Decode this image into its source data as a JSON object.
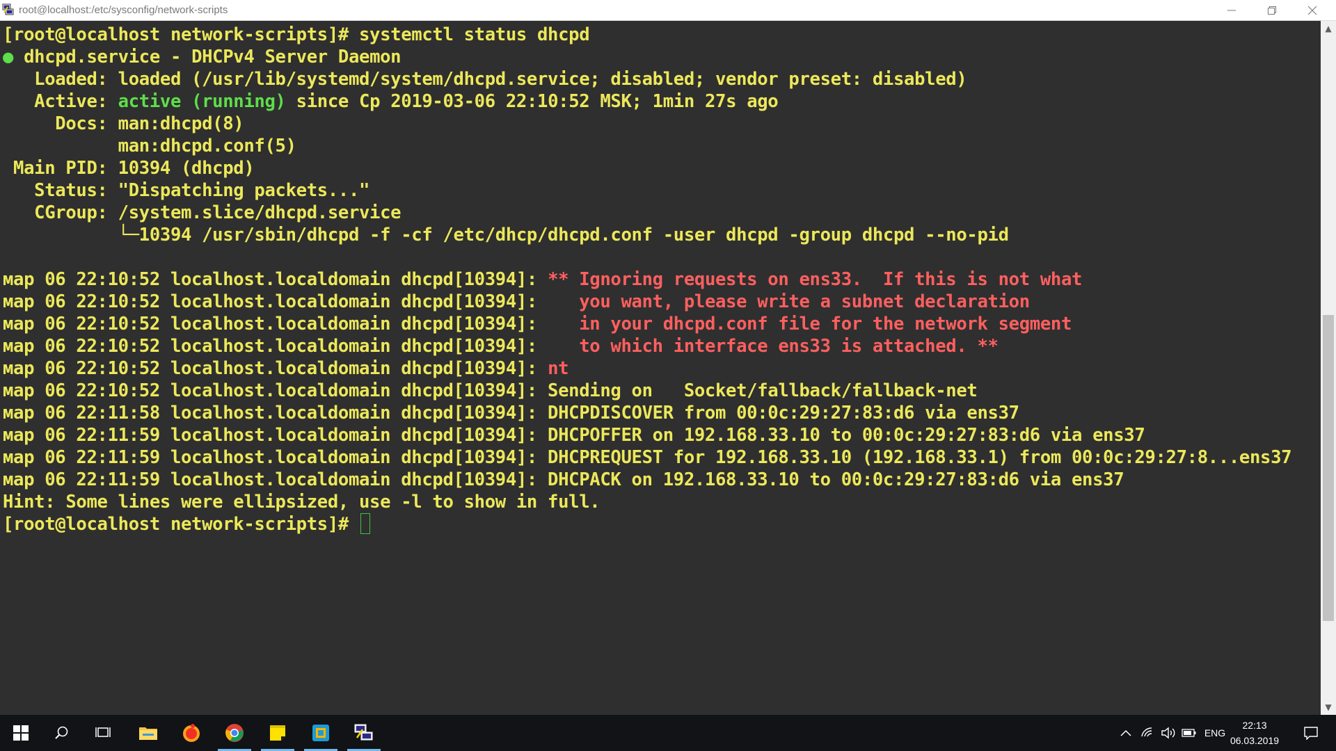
{
  "window": {
    "title": "root@localhost:/etc/sysconfig/network-scripts",
    "minimize_icon": "minimize-icon",
    "restore_icon": "restore-icon",
    "close_icon": "close-icon"
  },
  "terminal": {
    "lines": [
      {
        "segments": [
          {
            "text": "[root@localhost network-scripts]# systemctl status dhcpd",
            "color": "yellow"
          }
        ]
      },
      {
        "segments": [
          {
            "text": "● ",
            "color": "green"
          },
          {
            "text": "dhcpd.service - DHCPv4 Server Daemon",
            "color": "yellow"
          }
        ]
      },
      {
        "segments": [
          {
            "text": "   Loaded: loaded (/usr/lib/systemd/system/dhcpd.service; disabled; vendor preset: disabled)",
            "color": "yellow"
          }
        ]
      },
      {
        "segments": [
          {
            "text": "   Active: ",
            "color": "yellow"
          },
          {
            "text": "active (running)",
            "color": "green"
          },
          {
            "text": " since Ср 2019-03-06 22:10:52 MSK; 1min 27s ago",
            "color": "yellow"
          }
        ]
      },
      {
        "segments": [
          {
            "text": "     Docs: man:dhcpd(8)",
            "color": "yellow"
          }
        ]
      },
      {
        "segments": [
          {
            "text": "           man:dhcpd.conf(5)",
            "color": "yellow"
          }
        ]
      },
      {
        "segments": [
          {
            "text": " Main PID: 10394 (dhcpd)",
            "color": "yellow"
          }
        ]
      },
      {
        "segments": [
          {
            "text": "   Status: \"Dispatching packets...\"",
            "color": "yellow"
          }
        ]
      },
      {
        "segments": [
          {
            "text": "   CGroup: /system.slice/dhcpd.service",
            "color": "yellow"
          }
        ]
      },
      {
        "segments": [
          {
            "text": "           └─10394 /usr/sbin/dhcpd -f -cf /etc/dhcp/dhcpd.conf -user dhcpd -group dhcpd --no-pid",
            "color": "yellow"
          }
        ]
      },
      {
        "segments": [
          {
            "text": "",
            "color": "yellow"
          }
        ]
      },
      {
        "segments": [
          {
            "text": "мар 06 22:10:52 localhost.localdomain dhcpd[10394]: ",
            "color": "yellow"
          },
          {
            "text": "** Ignoring requests on ens33.  If this is not what",
            "color": "red"
          }
        ]
      },
      {
        "segments": [
          {
            "text": "мар 06 22:10:52 localhost.localdomain dhcpd[10394]: ",
            "color": "yellow"
          },
          {
            "text": "   you want, please write a subnet declaration",
            "color": "red"
          }
        ]
      },
      {
        "segments": [
          {
            "text": "мар 06 22:10:52 localhost.localdomain dhcpd[10394]: ",
            "color": "yellow"
          },
          {
            "text": "   in your dhcpd.conf file for the network segment",
            "color": "red"
          }
        ]
      },
      {
        "segments": [
          {
            "text": "мар 06 22:10:52 localhost.localdomain dhcpd[10394]: ",
            "color": "yellow"
          },
          {
            "text": "   to which interface ens33 is attached. **",
            "color": "red"
          }
        ]
      },
      {
        "segments": [
          {
            "text": "мар 06 22:10:52 localhost.localdomain dhcpd[10394]: ",
            "color": "yellow"
          },
          {
            "text": "nt",
            "color": "red"
          }
        ]
      },
      {
        "segments": [
          {
            "text": "мар 06 22:10:52 localhost.localdomain dhcpd[10394]: Sending on   Socket/fallback/fallback-net",
            "color": "yellow"
          }
        ]
      },
      {
        "segments": [
          {
            "text": "мар 06 22:11:58 localhost.localdomain dhcpd[10394]: DHCPDISCOVER from 00:0c:29:27:83:d6 via ens37",
            "color": "yellow"
          }
        ]
      },
      {
        "segments": [
          {
            "text": "мар 06 22:11:59 localhost.localdomain dhcpd[10394]: DHCPOFFER on 192.168.33.10 to 00:0c:29:27:83:d6 via ens37",
            "color": "yellow"
          }
        ]
      },
      {
        "segments": [
          {
            "text": "мар 06 22:11:59 localhost.localdomain dhcpd[10394]: DHCPREQUEST for 192.168.33.10 (192.168.33.1) from 00:0c:29:27:8...ens37",
            "color": "yellow"
          }
        ]
      },
      {
        "segments": [
          {
            "text": "мар 06 22:11:59 localhost.localdomain dhcpd[10394]: DHCPACK on 192.168.33.10 to 00:0c:29:27:83:d6 via ens37",
            "color": "yellow"
          }
        ]
      },
      {
        "segments": [
          {
            "text": "Hint: Some lines were ellipsized, use -l to show in full.",
            "color": "yellow"
          }
        ]
      },
      {
        "segments": [
          {
            "text": "[root@localhost network-scripts]# ",
            "color": "yellow"
          }
        ],
        "cursor": true
      }
    ]
  },
  "colors": {
    "background": "#2f2f2f",
    "yellow": "#ece85a",
    "green": "#5ede4a",
    "red": "#ff5f5f",
    "cursor": "#3ec43e",
    "taskbar": "#111317"
  },
  "scrollbar": {
    "thumb_position": 0.42,
    "up_icon": "scroll-up-icon",
    "down_icon": "scroll-down-icon"
  },
  "taskbar": {
    "pinned": [
      {
        "name": "windows-start-icon",
        "active": false
      },
      {
        "name": "search-icon",
        "active": false
      },
      {
        "name": "task-view-icon",
        "active": false
      },
      {
        "name": "file-explorer-icon",
        "active": false
      },
      {
        "name": "yandex-browser-icon",
        "active": false
      },
      {
        "name": "chrome-icon",
        "active": true
      },
      {
        "name": "sticky-notes-icon",
        "active": true
      },
      {
        "name": "vmware-icon",
        "active": true
      },
      {
        "name": "putty-icon",
        "active": true
      }
    ],
    "tray": {
      "chevron_icon": "show-hidden-icons-icon",
      "network_icon": "wifi-icon",
      "volume_icon": "volume-icon",
      "battery_icon": "battery-icon",
      "language": "ENG",
      "time": "22:13",
      "date": "06.03.2019",
      "notifications_icon": "action-center-icon"
    }
  }
}
